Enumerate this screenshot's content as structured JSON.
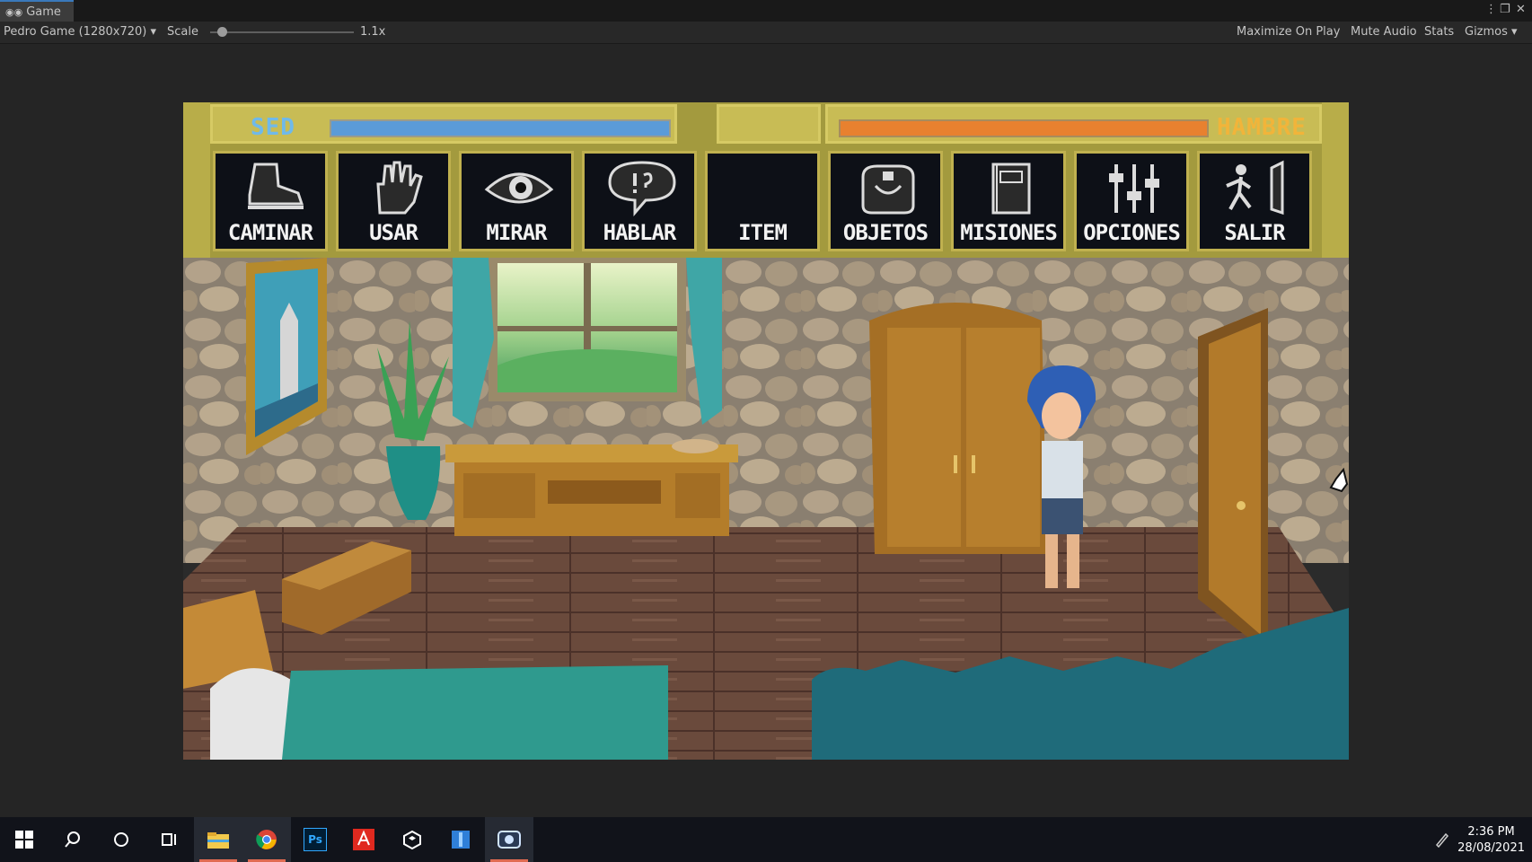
{
  "window": {
    "tab_label": "Game",
    "tab_icon": "gamepad-icon",
    "menu_icon": "kebab-icon",
    "maximize_icon": "maximize-icon",
    "close_icon": "close-icon"
  },
  "toolbar": {
    "display_select": "Pedro Game (1280x720)",
    "scale_label": "Scale",
    "scale_value": "1.1x",
    "scale_level": 0.05,
    "maximize": "Maximize On Play",
    "mute": "Mute Audio",
    "stats": "Stats",
    "gizmos": "Gizmos"
  },
  "game": {
    "hud": {
      "sed_label": "SED",
      "sed_level": 1.0,
      "sed_color": "#5b9bd8",
      "hambre_label": "HAMBRE",
      "hambre_level": 1.0,
      "hambre_color": "#e8812f"
    },
    "commands": [
      {
        "label": "CAMINAR",
        "icon": "boot-icon"
      },
      {
        "label": "USAR",
        "icon": "hand-icon"
      },
      {
        "label": "MIRAR",
        "icon": "eye-icon"
      },
      {
        "label": "HABLAR",
        "icon": "speech-bubble-icon"
      },
      {
        "label": "ITEM",
        "icon": ""
      },
      {
        "label": "OBJETOS",
        "icon": "bag-icon"
      },
      {
        "label": "MISIONES",
        "icon": "book-icon"
      },
      {
        "label": "OPCIONES",
        "icon": "sliders-icon"
      },
      {
        "label": "SALIR",
        "icon": "exit-door-icon"
      }
    ]
  },
  "taskbar": {
    "apps": [
      "windows-start-icon",
      "search-icon",
      "cortana-icon",
      "task-view-icon",
      "file-explorer-icon",
      "chrome-icon",
      "photoshop-icon",
      "acrobat-icon",
      "unity-icon",
      "visual-studio-icon",
      "screen-recorder-icon"
    ],
    "photoshop_text": "Ps",
    "time": "2:36 PM",
    "date": "28/08/2021"
  }
}
